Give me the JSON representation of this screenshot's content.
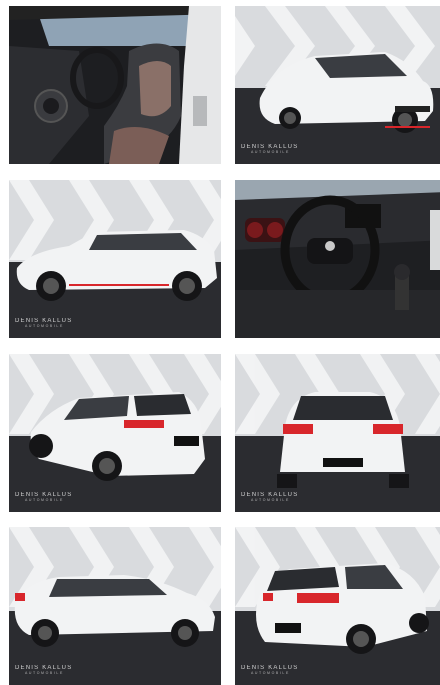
{
  "gallery": {
    "watermark": "DENIS KALLUS",
    "watermark_sub": "AUTOMOBILE",
    "photos": [
      {
        "view": "interior-seats",
        "icon": "car-interior-photo"
      },
      {
        "view": "front-three-quarter",
        "icon": "car-exterior-photo"
      },
      {
        "view": "side-left",
        "icon": "car-exterior-photo"
      },
      {
        "view": "dashboard-steering",
        "icon": "car-interior-photo"
      },
      {
        "view": "rear-three-quarter-left",
        "icon": "car-exterior-photo"
      },
      {
        "view": "rear",
        "icon": "car-exterior-photo"
      },
      {
        "view": "side-left-low",
        "icon": "car-exterior-photo"
      },
      {
        "view": "rear-three-quarter-right",
        "icon": "car-exterior-photo"
      }
    ]
  },
  "colors": {
    "car_body": "#f2f3f4",
    "studio_floor": "#2b2c30",
    "studio_wall": "#d9dbde",
    "accent_red": "#d8262b"
  }
}
